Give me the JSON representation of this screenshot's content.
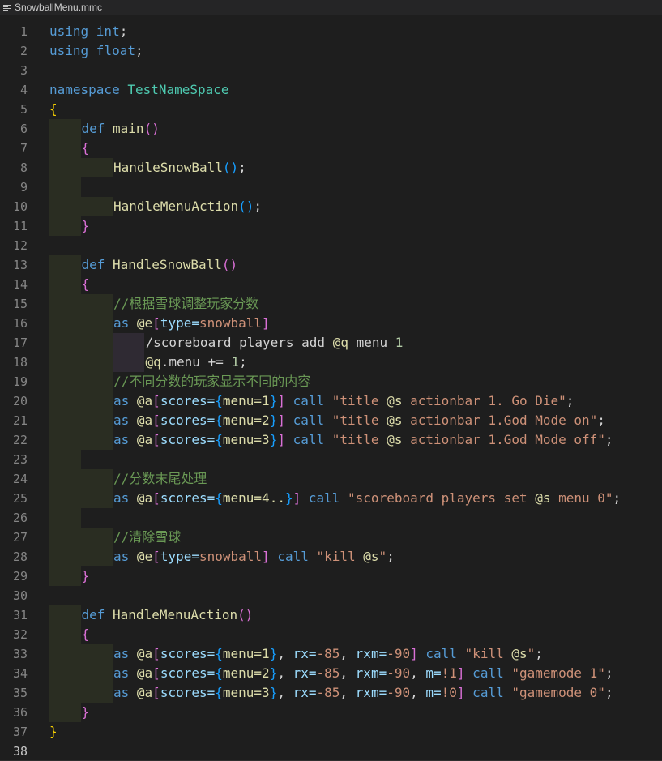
{
  "tab": {
    "title": "SnowballMenu.mmc",
    "icon": "file-lines-icon"
  },
  "colors": {
    "keyword": "#569cd6",
    "type": "#569cd6",
    "namespace": "#4ec9b0",
    "function": "#dcdcaa",
    "brace1": "#ffd700",
    "brace2": "#da70d6",
    "brace3": "#179fff",
    "comment": "#6a9955",
    "string": "#ce9178",
    "number": "#b5cea8",
    "selector": "#dcdcaa",
    "selectorArg": "#9cdcfe",
    "text": "#d4d4d4"
  },
  "current_line": 38,
  "lines": [
    {
      "n": "1",
      "indent": 0,
      "tokens": [
        [
          "using ",
          "kw"
        ],
        [
          "int",
          "kw2"
        ],
        [
          ";",
          "t"
        ]
      ]
    },
    {
      "n": "2",
      "indent": 0,
      "tokens": [
        [
          "using ",
          "kw"
        ],
        [
          "float",
          "kw2"
        ],
        [
          ";",
          "t"
        ]
      ]
    },
    {
      "n": "3",
      "indent": 0,
      "tokens": []
    },
    {
      "n": "4",
      "indent": 0,
      "tokens": [
        [
          "namespace ",
          "kw"
        ],
        [
          "TestNameSpace",
          "ns"
        ]
      ]
    },
    {
      "n": "5",
      "indent": 0,
      "tokens": [
        [
          "{",
          "b1"
        ]
      ]
    },
    {
      "n": "6",
      "indent": 1,
      "tokens": [
        [
          "def ",
          "kw"
        ],
        [
          "main",
          "fn"
        ],
        [
          "()",
          "b2"
        ]
      ]
    },
    {
      "n": "7",
      "indent": 1,
      "tokens": [
        [
          "{",
          "b2"
        ]
      ]
    },
    {
      "n": "8",
      "indent": 2,
      "tokens": [
        [
          "HandleSnowBall",
          "fn"
        ],
        [
          "()",
          "b3"
        ],
        [
          ";",
          "t"
        ]
      ]
    },
    {
      "n": "9",
      "indent": 1,
      "tokens": []
    },
    {
      "n": "10",
      "indent": 2,
      "tokens": [
        [
          "HandleMenuAction",
          "fn"
        ],
        [
          "()",
          "b3"
        ],
        [
          ";",
          "t"
        ]
      ]
    },
    {
      "n": "11",
      "indent": 1,
      "tokens": [
        [
          "}",
          "b2"
        ]
      ]
    },
    {
      "n": "12",
      "indent": 0,
      "tokens": []
    },
    {
      "n": "13",
      "indent": 1,
      "tokens": [
        [
          "def ",
          "kw"
        ],
        [
          "HandleSnowBall",
          "fn"
        ],
        [
          "()",
          "b2"
        ]
      ]
    },
    {
      "n": "14",
      "indent": 1,
      "tokens": [
        [
          "{",
          "b2"
        ]
      ]
    },
    {
      "n": "15",
      "indent": 2,
      "tokens": [
        [
          "//根据雪球调整玩家分数",
          "cm"
        ]
      ]
    },
    {
      "n": "16",
      "indent": 2,
      "tokens": [
        [
          "as ",
          "kw"
        ],
        [
          "@e",
          "sel"
        ],
        [
          "[",
          "b2"
        ],
        [
          "type=",
          "arg"
        ],
        [
          "snowball",
          "str"
        ],
        [
          "]",
          "b2"
        ]
      ]
    },
    {
      "n": "17",
      "indent": 3,
      "tokens": [
        [
          "/scoreboard players add ",
          "t"
        ],
        [
          "@q",
          "sel"
        ],
        [
          " menu ",
          "t"
        ],
        [
          "1",
          "num"
        ]
      ]
    },
    {
      "n": "18",
      "indent": 3,
      "tokens": [
        [
          "@q",
          "sel"
        ],
        [
          ".menu += ",
          "t"
        ],
        [
          "1",
          "num"
        ],
        [
          ";",
          "t"
        ]
      ]
    },
    {
      "n": "19",
      "indent": 2,
      "tokens": [
        [
          "//不同分数的玩家显示不同的内容",
          "cm"
        ]
      ]
    },
    {
      "n": "20",
      "indent": 2,
      "tokens": [
        [
          "as ",
          "kw"
        ],
        [
          "@a",
          "sel"
        ],
        [
          "[",
          "b2"
        ],
        [
          "scores=",
          "arg"
        ],
        [
          "{",
          "b3"
        ],
        [
          "menu=1",
          "sel"
        ],
        [
          "}",
          "b3"
        ],
        [
          "]",
          "b2"
        ],
        [
          " call ",
          "kw"
        ],
        [
          "\"title ",
          "str"
        ],
        [
          "@s",
          "sel"
        ],
        [
          " actionbar 1. Go Die\"",
          "str"
        ],
        [
          ";",
          "t"
        ]
      ]
    },
    {
      "n": "21",
      "indent": 2,
      "tokens": [
        [
          "as ",
          "kw"
        ],
        [
          "@a",
          "sel"
        ],
        [
          "[",
          "b2"
        ],
        [
          "scores=",
          "arg"
        ],
        [
          "{",
          "b3"
        ],
        [
          "menu=2",
          "sel"
        ],
        [
          "}",
          "b3"
        ],
        [
          "]",
          "b2"
        ],
        [
          " call ",
          "kw"
        ],
        [
          "\"title ",
          "str"
        ],
        [
          "@s",
          "sel"
        ],
        [
          " actionbar 1.God Mode on\"",
          "str"
        ],
        [
          ";",
          "t"
        ]
      ]
    },
    {
      "n": "22",
      "indent": 2,
      "tokens": [
        [
          "as ",
          "kw"
        ],
        [
          "@a",
          "sel"
        ],
        [
          "[",
          "b2"
        ],
        [
          "scores=",
          "arg"
        ],
        [
          "{",
          "b3"
        ],
        [
          "menu=3",
          "sel"
        ],
        [
          "}",
          "b3"
        ],
        [
          "]",
          "b2"
        ],
        [
          " call ",
          "kw"
        ],
        [
          "\"title ",
          "str"
        ],
        [
          "@s",
          "sel"
        ],
        [
          " actionbar 1.God Mode off\"",
          "str"
        ],
        [
          ";",
          "t"
        ]
      ]
    },
    {
      "n": "23",
      "indent": 1,
      "tokens": []
    },
    {
      "n": "24",
      "indent": 2,
      "tokens": [
        [
          "//分数末尾处理",
          "cm"
        ]
      ]
    },
    {
      "n": "25",
      "indent": 2,
      "tokens": [
        [
          "as ",
          "kw"
        ],
        [
          "@a",
          "sel"
        ],
        [
          "[",
          "b2"
        ],
        [
          "scores=",
          "arg"
        ],
        [
          "{",
          "b3"
        ],
        [
          "menu=4..",
          "sel"
        ],
        [
          "}",
          "b3"
        ],
        [
          "]",
          "b2"
        ],
        [
          " call ",
          "kw"
        ],
        [
          "\"scoreboard players set ",
          "str"
        ],
        [
          "@s",
          "sel"
        ],
        [
          " menu 0\"",
          "str"
        ],
        [
          ";",
          "t"
        ]
      ]
    },
    {
      "n": "26",
      "indent": 1,
      "tokens": []
    },
    {
      "n": "27",
      "indent": 2,
      "tokens": [
        [
          "//清除雪球",
          "cm"
        ]
      ]
    },
    {
      "n": "28",
      "indent": 2,
      "tokens": [
        [
          "as ",
          "kw"
        ],
        [
          "@e",
          "sel"
        ],
        [
          "[",
          "b2"
        ],
        [
          "type=",
          "arg"
        ],
        [
          "snowball",
          "str"
        ],
        [
          "]",
          "b2"
        ],
        [
          " call ",
          "kw"
        ],
        [
          "\"kill ",
          "str"
        ],
        [
          "@s",
          "sel"
        ],
        [
          "\"",
          "str"
        ],
        [
          ";",
          "t"
        ]
      ]
    },
    {
      "n": "29",
      "indent": 1,
      "tokens": [
        [
          "}",
          "b2"
        ]
      ]
    },
    {
      "n": "30",
      "indent": 0,
      "tokens": []
    },
    {
      "n": "31",
      "indent": 1,
      "tokens": [
        [
          "def ",
          "kw"
        ],
        [
          "HandleMenuAction",
          "fn"
        ],
        [
          "()",
          "b2"
        ]
      ]
    },
    {
      "n": "32",
      "indent": 1,
      "tokens": [
        [
          "{",
          "b2"
        ]
      ]
    },
    {
      "n": "33",
      "indent": 2,
      "tokens": [
        [
          "as ",
          "kw"
        ],
        [
          "@a",
          "sel"
        ],
        [
          "[",
          "b2"
        ],
        [
          "scores=",
          "arg"
        ],
        [
          "{",
          "b3"
        ],
        [
          "menu=1",
          "sel"
        ],
        [
          "}",
          "b3"
        ],
        [
          ", ",
          "t"
        ],
        [
          "rx=",
          "arg"
        ],
        [
          "-85",
          "str"
        ],
        [
          ", ",
          "t"
        ],
        [
          "rxm=",
          "arg"
        ],
        [
          "-90",
          "str"
        ],
        [
          "]",
          "b2"
        ],
        [
          " call ",
          "kw"
        ],
        [
          "\"kill ",
          "str"
        ],
        [
          "@s",
          "sel"
        ],
        [
          "\"",
          "str"
        ],
        [
          ";",
          "t"
        ]
      ]
    },
    {
      "n": "34",
      "indent": 2,
      "tokens": [
        [
          "as ",
          "kw"
        ],
        [
          "@a",
          "sel"
        ],
        [
          "[",
          "b2"
        ],
        [
          "scores=",
          "arg"
        ],
        [
          "{",
          "b3"
        ],
        [
          "menu=2",
          "sel"
        ],
        [
          "}",
          "b3"
        ],
        [
          ", ",
          "t"
        ],
        [
          "rx=",
          "arg"
        ],
        [
          "-85",
          "str"
        ],
        [
          ", ",
          "t"
        ],
        [
          "rxm=",
          "arg"
        ],
        [
          "-90",
          "str"
        ],
        [
          ", ",
          "t"
        ],
        [
          "m=",
          "arg"
        ],
        [
          "!1",
          "str"
        ],
        [
          "]",
          "b2"
        ],
        [
          " call ",
          "kw"
        ],
        [
          "\"gamemode 1\"",
          "str"
        ],
        [
          ";",
          "t"
        ]
      ]
    },
    {
      "n": "35",
      "indent": 2,
      "tokens": [
        [
          "as ",
          "kw"
        ],
        [
          "@a",
          "sel"
        ],
        [
          "[",
          "b2"
        ],
        [
          "scores=",
          "arg"
        ],
        [
          "{",
          "b3"
        ],
        [
          "menu=3",
          "sel"
        ],
        [
          "}",
          "b3"
        ],
        [
          ", ",
          "t"
        ],
        [
          "rx=",
          "arg"
        ],
        [
          "-85",
          "str"
        ],
        [
          ", ",
          "t"
        ],
        [
          "rxm=",
          "arg"
        ],
        [
          "-90",
          "str"
        ],
        [
          ", ",
          "t"
        ],
        [
          "m=",
          "arg"
        ],
        [
          "!0",
          "str"
        ],
        [
          "]",
          "b2"
        ],
        [
          " call ",
          "kw"
        ],
        [
          "\"gamemode 0\"",
          "str"
        ],
        [
          ";",
          "t"
        ]
      ]
    },
    {
      "n": "36",
      "indent": 1,
      "tokens": [
        [
          "}",
          "b2"
        ]
      ]
    },
    {
      "n": "37",
      "indent": 0,
      "tokens": [
        [
          "}",
          "b1"
        ]
      ]
    },
    {
      "n": "38",
      "indent": 0,
      "tokens": []
    }
  ]
}
